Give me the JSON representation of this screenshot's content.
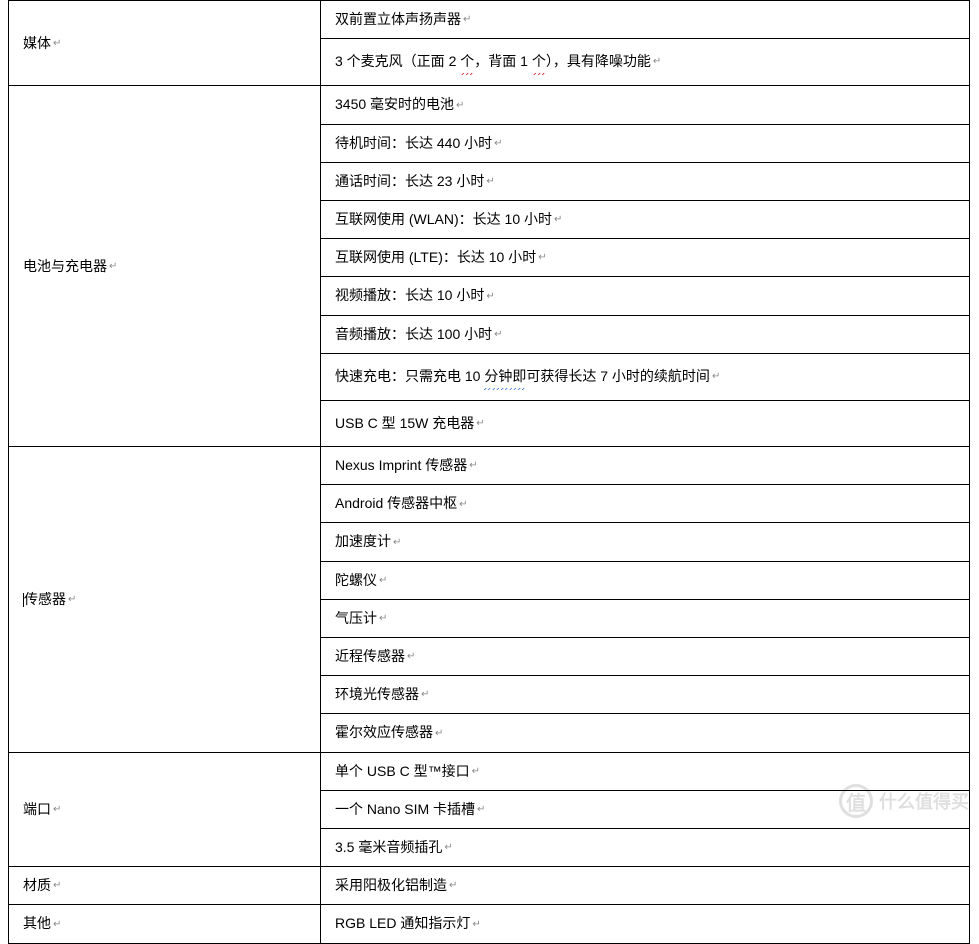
{
  "categories": {
    "media": "媒体",
    "battery": "电池与充电器",
    "sensors": "传感器",
    "ports": "端口",
    "material": "材质",
    "other": "其他"
  },
  "rows": {
    "media_speaker": "双前置立体声扬声器",
    "media_mic_a": "3 个麦克风（正面 2 ",
    "media_mic_b": "个",
    "media_mic_c": "，背面 1 ",
    "media_mic_d": "个",
    "media_mic_e": "），具有降噪功能",
    "bat_capacity": "3450 毫安时的电池",
    "bat_standby": "待机时间：长达 440 小时",
    "bat_talk": "通话时间：长达 23 小时",
    "bat_wlan": "互联网使用 (WLAN)：长达 10 小时",
    "bat_lte": "互联网使用 (LTE)：长达 10 小时",
    "bat_video": "视频播放：长达 10 小时",
    "bat_audio": "音频播放：长达 100 小时",
    "bat_fast_a": "快速充电：只需充电 10 ",
    "bat_fast_b": "分钟即",
    "bat_fast_c": "可获得长达 7 小时的续航时间",
    "bat_charger": "USB C 型 15W 充电器",
    "sen_imprint": "Nexus Imprint 传感器",
    "sen_android": "Android 传感器中枢",
    "sen_accel": "加速度计",
    "sen_gyro": "陀螺仪",
    "sen_baro": "气压计",
    "sen_prox": "近程传感器",
    "sen_light": "环境光传感器",
    "sen_hall": "霍尔效应传感器",
    "port_usbc": "单个 USB C 型™接口",
    "port_sim": "一个 Nano SIM 卡插槽",
    "port_audio": "3.5 毫米音频插孔",
    "mat_alum": "采用阳极化铝制造",
    "other_led": "RGB LED 通知指示灯"
  },
  "markers": {
    "return": "↵"
  },
  "watermark": {
    "icon": "值",
    "text": "什么值得买"
  }
}
